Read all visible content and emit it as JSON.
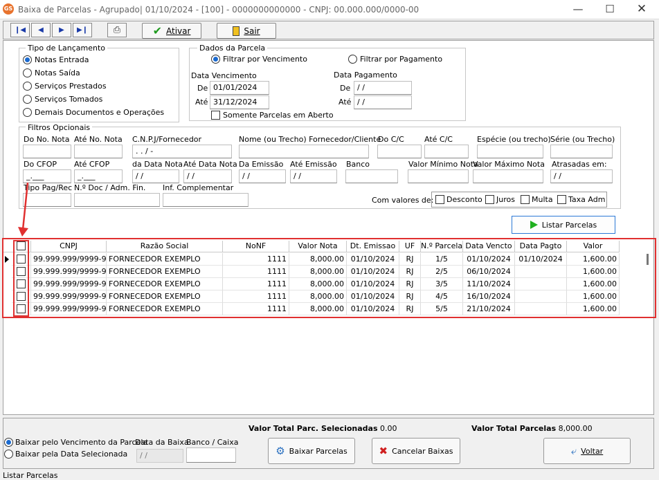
{
  "window": {
    "title": "Baixa de Parcelas - Agrupado|  01/10/2024 - [100] - 0000000000000 - CNPJ: 00.000.000/0000-00",
    "app_badge": "GS"
  },
  "toolbar": {
    "ativar": "Ativar",
    "sair": "Sair"
  },
  "tipo": {
    "legend": "Tipo de Lançamento",
    "options": [
      "Notas Entrada",
      "Notas Saída",
      "Serviços Prestados",
      "Serviços Tomados",
      "Demais Documentos e Operações"
    ],
    "selected": 0
  },
  "dados": {
    "legend": "Dados da Parcela",
    "filtro_venc": "Filtrar por Vencimento",
    "filtro_pag": "Filtrar por Pagamento",
    "data_venc_label": "Data Vencimento",
    "data_pag_label": "Data Pagamento",
    "de": "De",
    "ate": "Até",
    "venc_de": "01/01/2024",
    "venc_ate": "31/12/2024",
    "pag_de": "  /  /",
    "pag_ate": "  /  /",
    "somente_aberto": "Somente Parcelas em Aberto"
  },
  "filtros": {
    "legend": "Filtros Opcionais",
    "do_no_nota": "Do No. Nota",
    "ate_no_nota": "Até No. Nota",
    "cnpj": "C.N.P.J/Fornecedor",
    "cnpj_mask": "  .   .   /   -",
    "nome": "Nome (ou Trecho) Fornecedor/Cliente",
    "do_cc": "Do C/C",
    "ate_cc": "Até C/C",
    "especie": "Espécie (ou trecho)",
    "serie": "Série (ou Trecho)",
    "do_cfop": "Do CFOP",
    "ate_cfop": "Até CFOP",
    "cfop_mask": "_.___",
    "da_data_nota": "da Data Nota",
    "ate_data_nota": "Até Data Nota",
    "da_emissao": "Da Emissão",
    "ate_emissao": "Até Emissão",
    "banco": "Banco",
    "valor_min": "Valor Mínimo Nota",
    "valor_max": "Valor Máximo Nota",
    "atrasadas": "Atrasadas em:",
    "date_mask": "  /  /",
    "tipo_pag": "Tipo Pag/Rec",
    "n_doc": "N.º Doc / Adm. Fin.",
    "inf_comp": "Inf. Complementar",
    "com_valores": "Com valores de:",
    "desconto": "Desconto",
    "juros": "Juros",
    "multa": "Multa",
    "taxa_adm": "Taxa Adm"
  },
  "listar_button": "Listar Parcelas",
  "table": {
    "columns": [
      "CNPJ",
      "Razão Social",
      "NoNF",
      "Valor Nota",
      "Dt. Emissao",
      "UF",
      "N.º Parcela",
      "Data Vencto",
      "Data Pagto",
      "Valor"
    ],
    "rows": [
      [
        "99.999.999/9999-99",
        "FORNECEDOR EXEMPLO",
        "1111",
        "8,000.00",
        "01/10/2024",
        "RJ",
        "1/5",
        "01/10/2024",
        "01/10/2024",
        "1,600.00"
      ],
      [
        "99.999.999/9999-99",
        "FORNECEDOR EXEMPLO",
        "1111",
        "8,000.00",
        "01/10/2024",
        "RJ",
        "2/5",
        "06/10/2024",
        "",
        "1,600.00"
      ],
      [
        "99.999.999/9999-99",
        "FORNECEDOR EXEMPLO",
        "1111",
        "8,000.00",
        "01/10/2024",
        "RJ",
        "3/5",
        "11/10/2024",
        "",
        "1,600.00"
      ],
      [
        "99.999.999/9999-99",
        "FORNECEDOR EXEMPLO",
        "1111",
        "8,000.00",
        "01/10/2024",
        "RJ",
        "4/5",
        "16/10/2024",
        "",
        "1,600.00"
      ],
      [
        "99.999.999/9999-99",
        "FORNECEDOR EXEMPLO",
        "1111",
        "8,000.00",
        "01/10/2024",
        "RJ",
        "5/5",
        "21/10/2024",
        "",
        "1,600.00"
      ]
    ]
  },
  "bottom": {
    "total_sel_label": "Valor Total Parc. Selecionadas",
    "total_sel_value": "0.00",
    "total_label": "Valor Total Parcelas",
    "total_value": "8,000.00",
    "baixar_venc": "Baixar pelo Vencimento da Parcela",
    "baixar_data": "Baixar pela Data Selecionada",
    "data_baixa": "Data da Baixa",
    "data_baixa_value": "  /  /",
    "banco_caixa": "Banco / Caixa",
    "btn_baixar": "Baixar Parcelas",
    "btn_cancelar": "Cancelar Baixas",
    "btn_voltar": "Voltar"
  },
  "status": "Listar Parcelas",
  "colors": {
    "highlight": "#e03030",
    "accent": "#1a6ad0"
  }
}
